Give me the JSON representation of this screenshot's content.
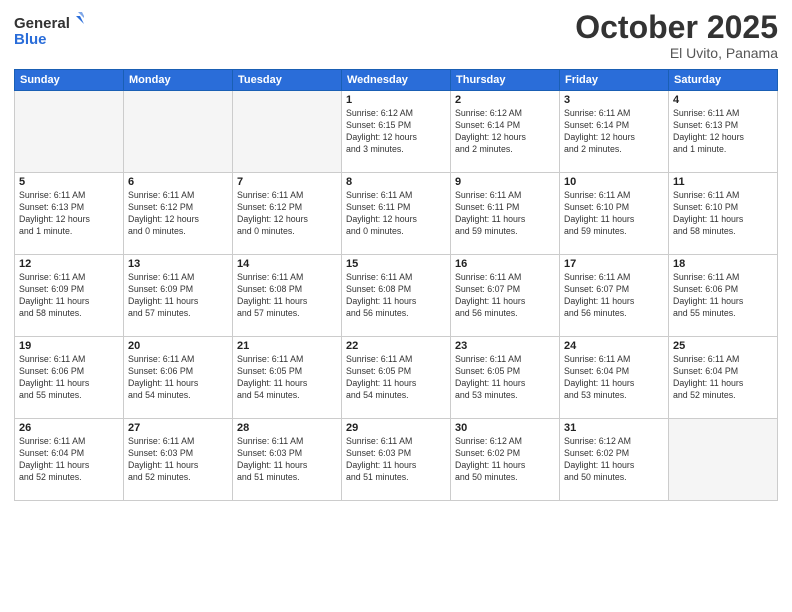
{
  "header": {
    "logo_line1": "General",
    "logo_line2": "Blue",
    "month": "October 2025",
    "location": "El Uvito, Panama"
  },
  "days_of_week": [
    "Sunday",
    "Monday",
    "Tuesday",
    "Wednesday",
    "Thursday",
    "Friday",
    "Saturday"
  ],
  "weeks": [
    [
      {
        "num": "",
        "info": ""
      },
      {
        "num": "",
        "info": ""
      },
      {
        "num": "",
        "info": ""
      },
      {
        "num": "1",
        "info": "Sunrise: 6:12 AM\nSunset: 6:15 PM\nDaylight: 12 hours\nand 3 minutes."
      },
      {
        "num": "2",
        "info": "Sunrise: 6:12 AM\nSunset: 6:14 PM\nDaylight: 12 hours\nand 2 minutes."
      },
      {
        "num": "3",
        "info": "Sunrise: 6:11 AM\nSunset: 6:14 PM\nDaylight: 12 hours\nand 2 minutes."
      },
      {
        "num": "4",
        "info": "Sunrise: 6:11 AM\nSunset: 6:13 PM\nDaylight: 12 hours\nand 1 minute."
      }
    ],
    [
      {
        "num": "5",
        "info": "Sunrise: 6:11 AM\nSunset: 6:13 PM\nDaylight: 12 hours\nand 1 minute."
      },
      {
        "num": "6",
        "info": "Sunrise: 6:11 AM\nSunset: 6:12 PM\nDaylight: 12 hours\nand 0 minutes."
      },
      {
        "num": "7",
        "info": "Sunrise: 6:11 AM\nSunset: 6:12 PM\nDaylight: 12 hours\nand 0 minutes."
      },
      {
        "num": "8",
        "info": "Sunrise: 6:11 AM\nSunset: 6:11 PM\nDaylight: 12 hours\nand 0 minutes."
      },
      {
        "num": "9",
        "info": "Sunrise: 6:11 AM\nSunset: 6:11 PM\nDaylight: 11 hours\nand 59 minutes."
      },
      {
        "num": "10",
        "info": "Sunrise: 6:11 AM\nSunset: 6:10 PM\nDaylight: 11 hours\nand 59 minutes."
      },
      {
        "num": "11",
        "info": "Sunrise: 6:11 AM\nSunset: 6:10 PM\nDaylight: 11 hours\nand 58 minutes."
      }
    ],
    [
      {
        "num": "12",
        "info": "Sunrise: 6:11 AM\nSunset: 6:09 PM\nDaylight: 11 hours\nand 58 minutes."
      },
      {
        "num": "13",
        "info": "Sunrise: 6:11 AM\nSunset: 6:09 PM\nDaylight: 11 hours\nand 57 minutes."
      },
      {
        "num": "14",
        "info": "Sunrise: 6:11 AM\nSunset: 6:08 PM\nDaylight: 11 hours\nand 57 minutes."
      },
      {
        "num": "15",
        "info": "Sunrise: 6:11 AM\nSunset: 6:08 PM\nDaylight: 11 hours\nand 56 minutes."
      },
      {
        "num": "16",
        "info": "Sunrise: 6:11 AM\nSunset: 6:07 PM\nDaylight: 11 hours\nand 56 minutes."
      },
      {
        "num": "17",
        "info": "Sunrise: 6:11 AM\nSunset: 6:07 PM\nDaylight: 11 hours\nand 56 minutes."
      },
      {
        "num": "18",
        "info": "Sunrise: 6:11 AM\nSunset: 6:06 PM\nDaylight: 11 hours\nand 55 minutes."
      }
    ],
    [
      {
        "num": "19",
        "info": "Sunrise: 6:11 AM\nSunset: 6:06 PM\nDaylight: 11 hours\nand 55 minutes."
      },
      {
        "num": "20",
        "info": "Sunrise: 6:11 AM\nSunset: 6:06 PM\nDaylight: 11 hours\nand 54 minutes."
      },
      {
        "num": "21",
        "info": "Sunrise: 6:11 AM\nSunset: 6:05 PM\nDaylight: 11 hours\nand 54 minutes."
      },
      {
        "num": "22",
        "info": "Sunrise: 6:11 AM\nSunset: 6:05 PM\nDaylight: 11 hours\nand 54 minutes."
      },
      {
        "num": "23",
        "info": "Sunrise: 6:11 AM\nSunset: 6:05 PM\nDaylight: 11 hours\nand 53 minutes."
      },
      {
        "num": "24",
        "info": "Sunrise: 6:11 AM\nSunset: 6:04 PM\nDaylight: 11 hours\nand 53 minutes."
      },
      {
        "num": "25",
        "info": "Sunrise: 6:11 AM\nSunset: 6:04 PM\nDaylight: 11 hours\nand 52 minutes."
      }
    ],
    [
      {
        "num": "26",
        "info": "Sunrise: 6:11 AM\nSunset: 6:04 PM\nDaylight: 11 hours\nand 52 minutes."
      },
      {
        "num": "27",
        "info": "Sunrise: 6:11 AM\nSunset: 6:03 PM\nDaylight: 11 hours\nand 52 minutes."
      },
      {
        "num": "28",
        "info": "Sunrise: 6:11 AM\nSunset: 6:03 PM\nDaylight: 11 hours\nand 51 minutes."
      },
      {
        "num": "29",
        "info": "Sunrise: 6:11 AM\nSunset: 6:03 PM\nDaylight: 11 hours\nand 51 minutes."
      },
      {
        "num": "30",
        "info": "Sunrise: 6:12 AM\nSunset: 6:02 PM\nDaylight: 11 hours\nand 50 minutes."
      },
      {
        "num": "31",
        "info": "Sunrise: 6:12 AM\nSunset: 6:02 PM\nDaylight: 11 hours\nand 50 minutes."
      },
      {
        "num": "",
        "info": ""
      }
    ]
  ]
}
